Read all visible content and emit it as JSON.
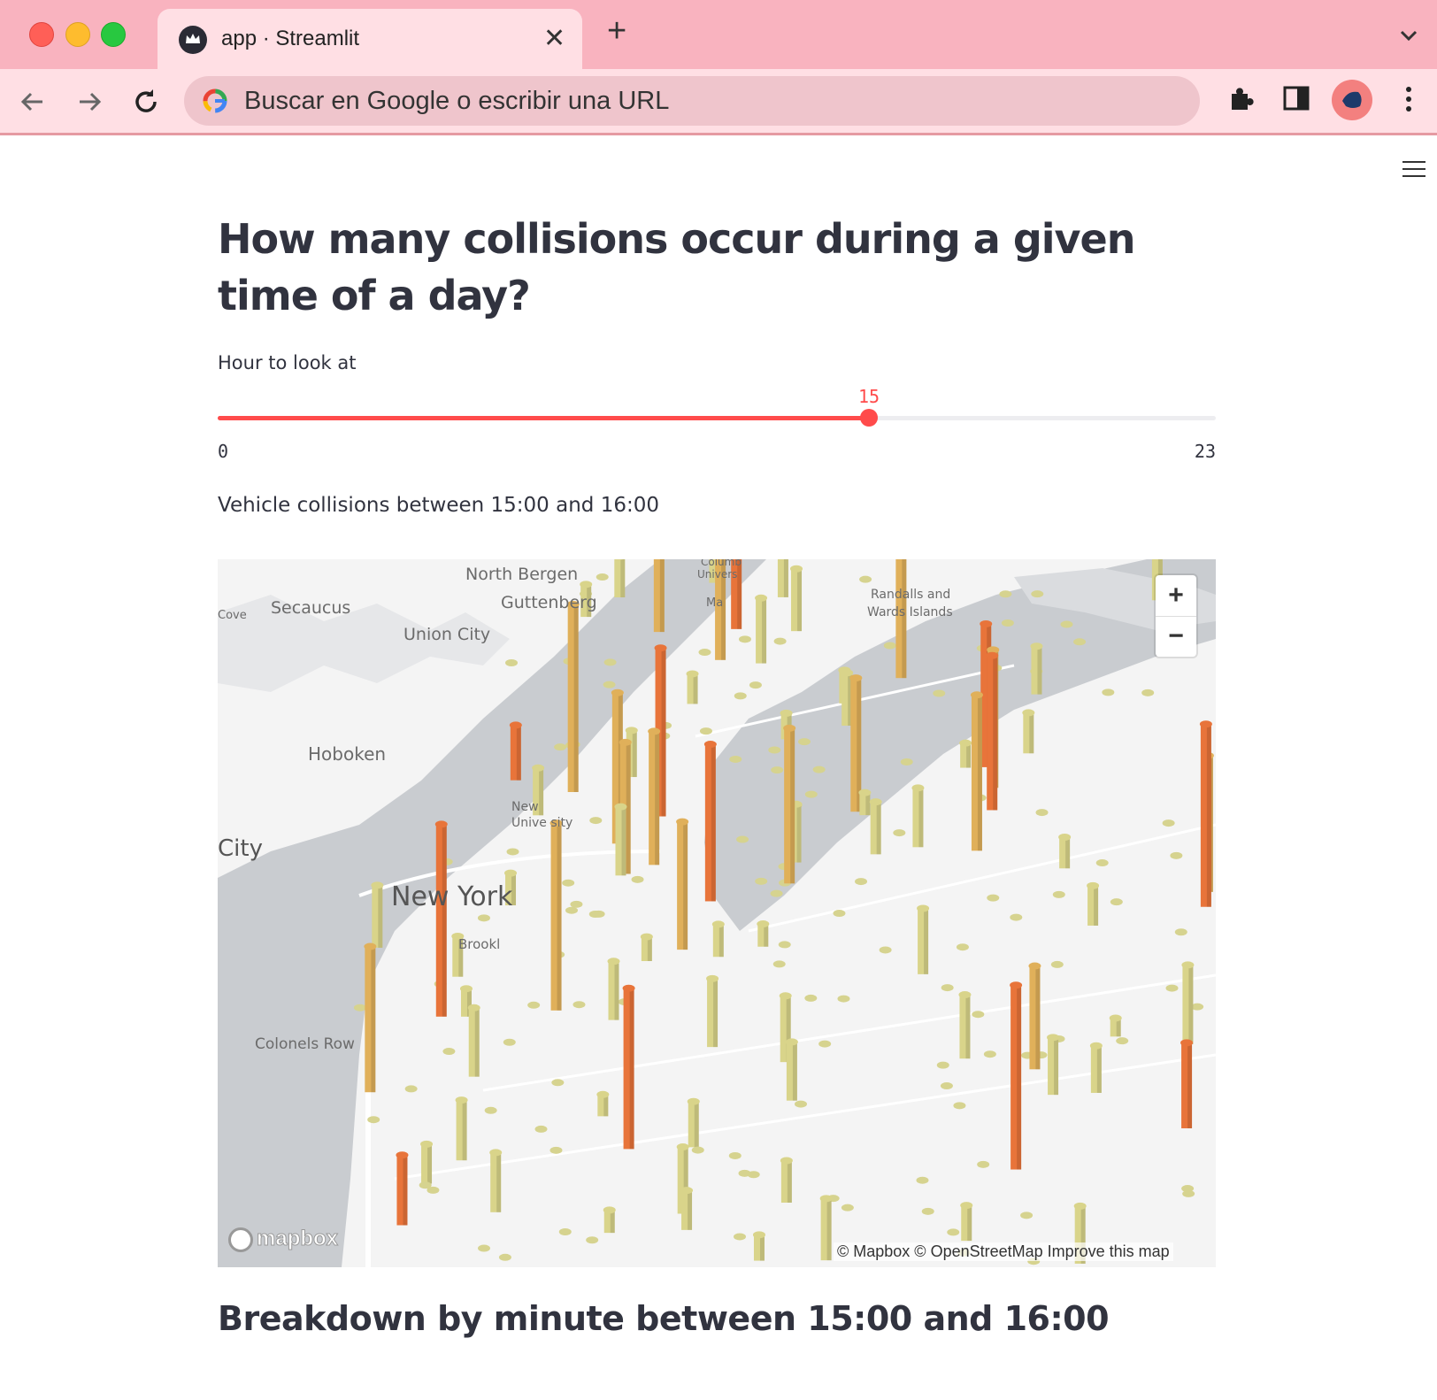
{
  "browser": {
    "tab_title": "app · Streamlit",
    "tab_close": "✕",
    "new_tab": "+",
    "omnibox_placeholder": "Buscar en Google o escribir una URL",
    "icons": [
      "back-arrow-icon",
      "forward-arrow-icon",
      "reload-icon",
      "google-icon",
      "extensions-icon",
      "side-panel-icon",
      "profile-avatar",
      "kebab-menu-icon",
      "tab-list-icon"
    ]
  },
  "page": {
    "title": "How many collisions occur during a given time of a day?",
    "slider": {
      "label": "Hour to look at",
      "min_label": "0",
      "max_label": "23",
      "value_label": "15",
      "min": 0,
      "max": 23,
      "value": 15,
      "accent": "#ff4b4b"
    },
    "map_caption": "Vehicle collisions between 15:00 and 16:00",
    "breakdown_title": "Breakdown by minute between 15:00 and 16:00"
  },
  "map": {
    "labels": {
      "north_bergen": "North Bergen",
      "secaucus": "Secaucus",
      "cove": "Cove",
      "guttenberg": "Guttenberg",
      "union_city": "Union City",
      "randalls": "Randalls and",
      "wards": "Wards Islands",
      "hoboken": "Hoboken",
      "city": "City",
      "new_york": "New York",
      "brooklyn": "Brookl",
      "colonels_row": "Colonels Row",
      "nyu": "New",
      "nyu2": "Unive sity",
      "columbia": "Columb",
      "univers": "Univers",
      "ma": "Ma"
    },
    "zoom_in": "+",
    "zoom_out": "−",
    "logo": "mapbox",
    "attribution": "© Mapbox © OpenStreetMap  Improve this map",
    "colors": {
      "low": "#d9d48a",
      "mid": "#e0b05a",
      "high": "#e8743a",
      "water": "#c9ccd0",
      "land": "#f4f4f4"
    }
  }
}
